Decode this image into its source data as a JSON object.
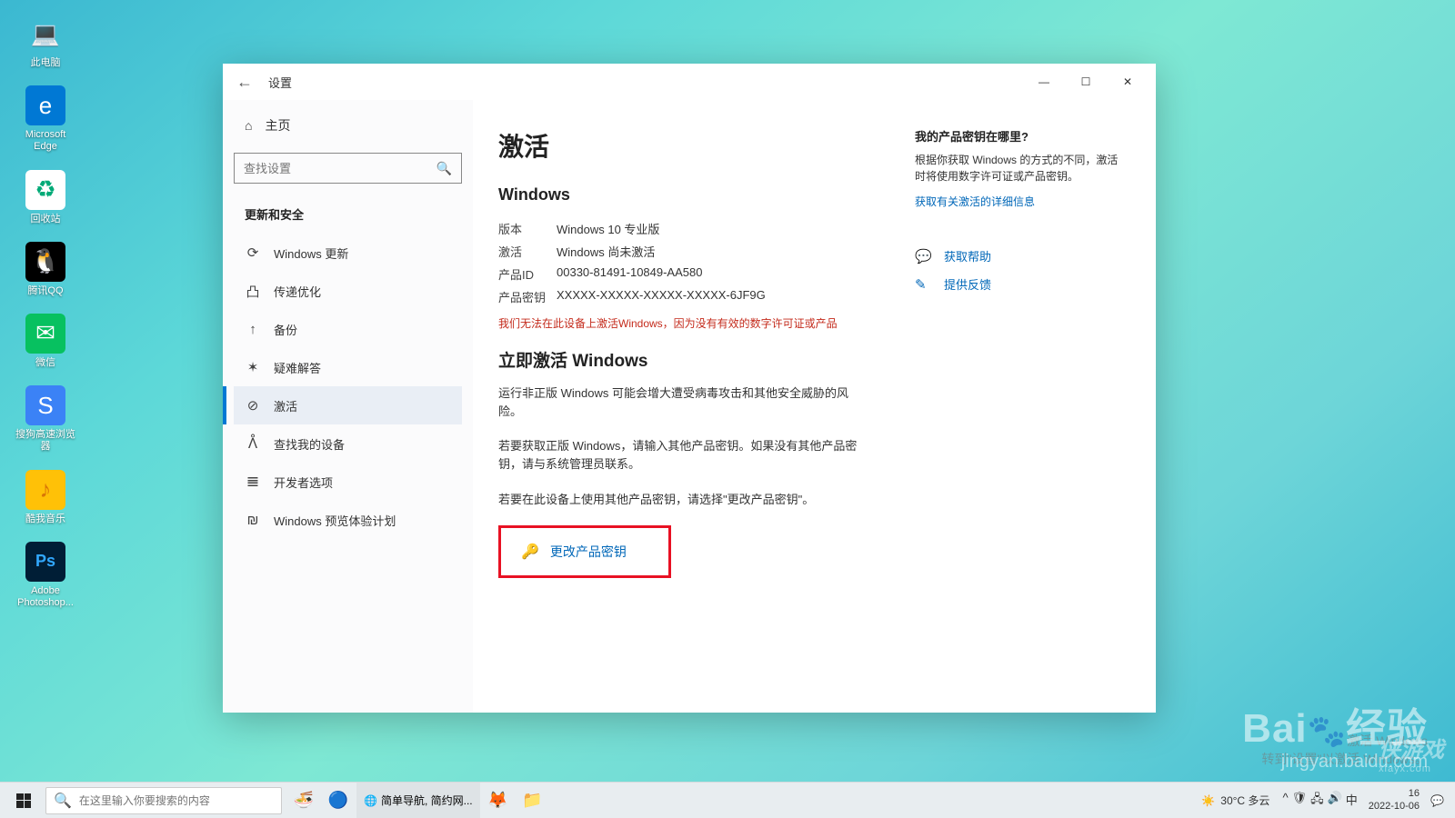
{
  "desktop": {
    "icons": [
      {
        "label": "此电脑",
        "emoji": "💻",
        "bg": "transparent"
      },
      {
        "label": "Microsoft Edge",
        "emoji": "🌐",
        "bg": "#0078d4"
      },
      {
        "label": "回收站",
        "emoji": "♻️",
        "bg": "#fff"
      },
      {
        "label": "腾讯QQ",
        "emoji": "🐧",
        "bg": "#000"
      },
      {
        "label": "微信",
        "emoji": "💬",
        "bg": "#07c160"
      },
      {
        "label": "搜狗高速浏览器",
        "emoji": "🔵",
        "bg": "#3b82f6"
      },
      {
        "label": "酷我音乐",
        "emoji": "🎵",
        "bg": "#ffc107"
      },
      {
        "label": "Adobe Photoshop...",
        "emoji": "Ps",
        "bg": "#001e36"
      }
    ]
  },
  "window": {
    "title": "设置",
    "home": "主页",
    "search_placeholder": "查找设置",
    "section": "更新和安全",
    "nav": [
      {
        "label": "Windows 更新"
      },
      {
        "label": "传递优化"
      },
      {
        "label": "备份"
      },
      {
        "label": "疑难解答"
      },
      {
        "label": "激活"
      },
      {
        "label": "查找我的设备"
      },
      {
        "label": "开发者选项"
      },
      {
        "label": "Windows 预览体验计划"
      }
    ]
  },
  "main": {
    "h1": "激活",
    "h2": "Windows",
    "rows": {
      "edition_k": "版本",
      "edition_v": "Windows 10 专业版",
      "status_k": "激活",
      "status_v": "Windows 尚未激活",
      "pid_k": "产品ID",
      "pid_v": "00330-81491-10849-AA580",
      "pkey_k": "产品密钥",
      "pkey_v": "XXXXX-XXXXX-XXXXX-XXXXX-6JF9G"
    },
    "error": "我们无法在此设备上激活Windows，因为没有有效的数字许可证或产品",
    "h3": "立即激活 Windows",
    "p1": "运行非正版 Windows 可能会增大遭受病毒攻击和其他安全威胁的风险。",
    "p2": "若要获取正版 Windows，请输入其他产品密钥。如果没有其他产品密钥，请与系统管理员联系。",
    "p3": "若要在此设备上使用其他产品密钥，请选择\"更改产品密钥\"。",
    "change_key": "更改产品密钥"
  },
  "side": {
    "q_title": "我的产品密钥在哪里?",
    "q_body": "根据你获取 Windows 的方式的不同，激活时将使用数字许可证或产品密钥。",
    "q_link": "获取有关激活的详细信息",
    "help": "获取帮助",
    "feedback": "提供反馈"
  },
  "taskbar": {
    "search_placeholder": "在这里输入你要搜索的内容",
    "browser_tab": "简单导航, 简约网...",
    "weather": "30°C 多云",
    "time": "16",
    "date": "2022-10-06"
  },
  "watermark": {
    "logo": "Bai",
    "logo2": "经验",
    "url": "jingyan.baidu.com",
    "activate1": "激活 Windows",
    "activate2": "转到\"设置\"以激活 Windows。",
    "site": "侠游戏",
    "site_sub": "xiayx.com"
  }
}
